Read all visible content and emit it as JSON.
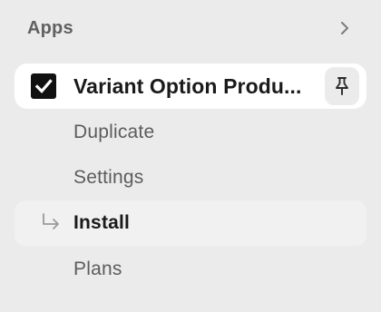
{
  "section": {
    "title": "Apps",
    "chevron_icon": "chevron-right-icon"
  },
  "app": {
    "name": "Variant Option Produ...",
    "icon": "checkmark-icon",
    "pin_icon": "pin-icon"
  },
  "sub_items": [
    {
      "label": "Duplicate",
      "active": false
    },
    {
      "label": "Settings",
      "active": false
    },
    {
      "label": "Install",
      "active": true,
      "icon": "subdirectory-arrow-icon"
    },
    {
      "label": "Plans",
      "active": false
    }
  ],
  "colors": {
    "background": "#ebebeb",
    "card": "#ffffff",
    "active_item": "#f1f1f1",
    "text_primary": "#1a1a1a",
    "text_secondary": "#5c5c5c"
  }
}
